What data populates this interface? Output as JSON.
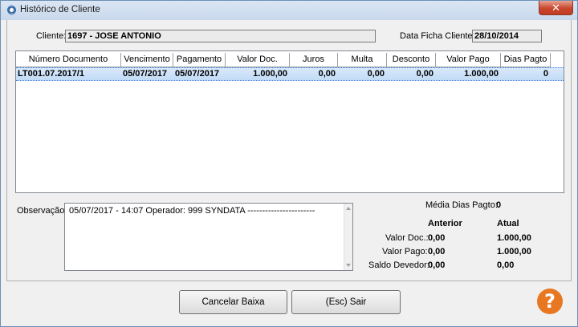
{
  "window": {
    "title": "Histórico de Cliente",
    "close_glyph": "✕"
  },
  "client": {
    "label": "Cliente:",
    "value": "1697 - JOSE ANTONIO",
    "date_label": "Data Ficha Cliente:",
    "date_value": "28/10/2014"
  },
  "grid": {
    "columns": [
      "Número Documento",
      "Vencimento",
      "Pagamento",
      "Valor Doc.",
      "Juros",
      "Multa",
      "Desconto",
      "Valor Pago",
      "Dias Pagto"
    ],
    "rows": [
      [
        "LT001.07.2017/1",
        "05/07/2017",
        "05/07/2017",
        "1.000,00",
        "0,00",
        "0,00",
        "0,00",
        "1.000,00",
        "0"
      ]
    ]
  },
  "observacao": {
    "label": "Observação:",
    "text": "05/07/2017 - 14:07 Operador: 999 SYNDATA -----------------------"
  },
  "summary": {
    "media_label": "Média Dias Pagto:",
    "media_value": "0",
    "anterior_header": "Anterior",
    "atual_header": "Atual",
    "rows": [
      {
        "label": "Valor Doc.:",
        "anterior": "0,00",
        "atual": "1.000,00"
      },
      {
        "label": "Valor Pago:",
        "anterior": "0,00",
        "atual": "1.000,00"
      },
      {
        "label": "Saldo Devedor:",
        "anterior": "0,00",
        "atual": "0,00"
      }
    ]
  },
  "buttons": {
    "cancelar": "Cancelar Baixa",
    "sair": "(Esc) Sair",
    "help_glyph": "?"
  },
  "colors": {
    "accent_selection": "#c2dcf6",
    "help": "#e87722",
    "close": "#c8472d"
  }
}
